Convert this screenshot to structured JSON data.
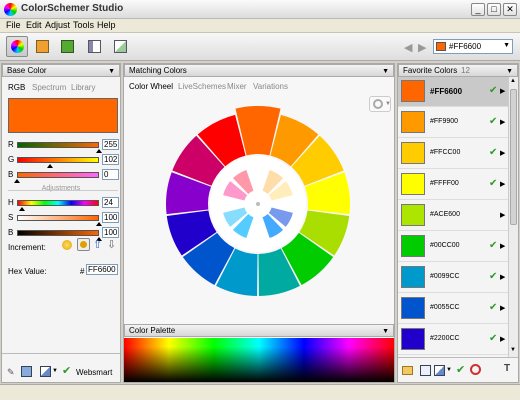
{
  "window": {
    "title": "ColorSchemer Studio",
    "buttons": [
      "_",
      "□",
      "✕"
    ]
  },
  "menu": [
    "File",
    "Edit",
    "Adjust",
    "Tools",
    "Help"
  ],
  "toolbar": {
    "current_hex": "#FF6600",
    "current_color": "#ff6600"
  },
  "left": {
    "header": "Base Color",
    "tabs": [
      "RGB",
      "Spectrum",
      "Library"
    ],
    "base_color": "#ff6600",
    "rgb": [
      {
        "label": "R",
        "value": "255",
        "level": 1.0
      },
      {
        "label": "G",
        "value": "102",
        "level": 0.4
      },
      {
        "label": "B",
        "value": "0",
        "level": 0.0
      }
    ],
    "adjustments_label": "Adjustments",
    "hsb": [
      {
        "label": "H",
        "value": "24",
        "level": 0.067
      },
      {
        "label": "S",
        "value": "100",
        "level": 1.0
      },
      {
        "label": "B",
        "value": "100",
        "level": 1.0
      }
    ],
    "increment_label": "Increment:",
    "hex_label": "Hex Value:",
    "hex_hash": "#",
    "hex_value": "FF6600",
    "websmart_label": "Websmart"
  },
  "middle": {
    "header": "Matching Colors",
    "tabs": [
      "Color Wheel",
      "LiveSchemes",
      "Mixer",
      "Variations"
    ],
    "palette_header": "Color Palette",
    "wheel_colors": [
      "#ff6600",
      "#ff9900",
      "#ffcc00",
      "#ffff00",
      "#aadd00",
      "#00cc00",
      "#00aaa0",
      "#0099cc",
      "#0055cc",
      "#2200cc",
      "#8800cc",
      "#cc0066",
      "#ff0000"
    ],
    "inner_colors": [
      "#ff99cc",
      "#ff99aa",
      "#ffddaa",
      "#ffeebb",
      "#88ddff",
      "#55ccff",
      "#44aaff",
      "#7799ee"
    ]
  },
  "right": {
    "header": "Favorite Colors",
    "count_label": "12",
    "items": [
      {
        "hex": "#FF6600",
        "color": "#ff6600",
        "checked": true
      },
      {
        "hex": "#FF9900",
        "color": "#ff9900",
        "checked": true
      },
      {
        "hex": "#FFCC00",
        "color": "#ffcc00",
        "checked": true
      },
      {
        "hex": "#FFFF00",
        "color": "#ffff00",
        "checked": true
      },
      {
        "hex": "#ACE600",
        "color": "#ace600",
        "checked": false
      },
      {
        "hex": "#00CC00",
        "color": "#00cc00",
        "checked": true
      },
      {
        "hex": "#0099CC",
        "color": "#0099cc",
        "checked": true
      },
      {
        "hex": "#0055CC",
        "color": "#0055cc",
        "checked": true
      },
      {
        "hex": "#2200CC",
        "color": "#2200cc",
        "checked": true
      }
    ]
  }
}
